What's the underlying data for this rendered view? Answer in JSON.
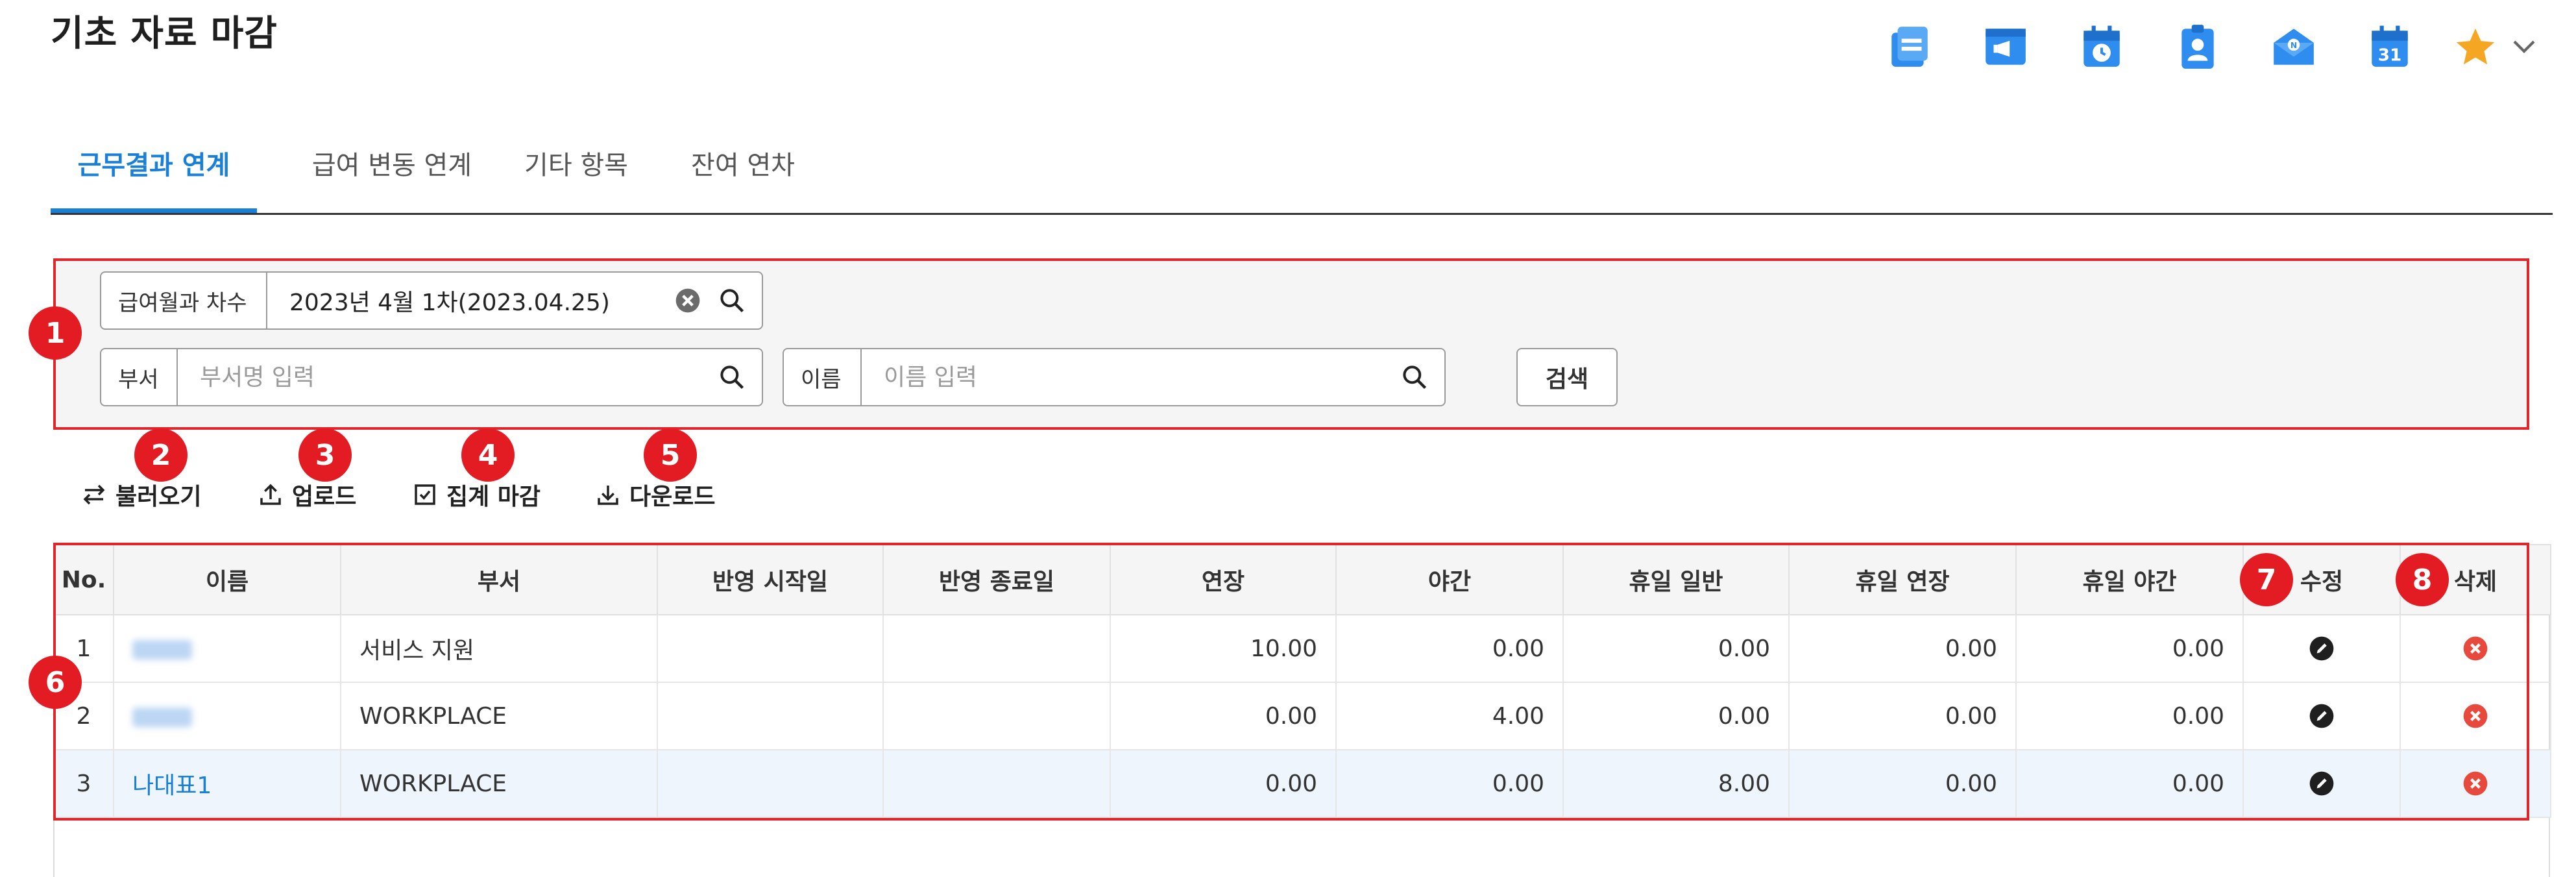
{
  "page": {
    "title": "기초 자료 마감"
  },
  "header": {
    "quick_icons": [
      {
        "icon": "board-icon",
        "color": "#2f8df0"
      },
      {
        "icon": "notice-icon",
        "color": "#2f8df0"
      },
      {
        "icon": "schedule-icon",
        "color": "#2f8df0"
      },
      {
        "icon": "id-card-icon",
        "color": "#2f8df0"
      },
      {
        "icon": "mail-icon",
        "color": "#2f8df0"
      },
      {
        "icon": "calendar-icon",
        "color": "#2f8df0",
        "text": "31"
      }
    ],
    "favorite": {
      "icon": "star-icon",
      "color": "#f5a623"
    }
  },
  "tabs": [
    {
      "label": "근무결과 연계",
      "active": true
    },
    {
      "label": "급여 변동 연계",
      "active": false
    },
    {
      "label": "기타 항목",
      "active": false
    },
    {
      "label": "잔여 연차",
      "active": false
    }
  ],
  "filters": {
    "period": {
      "label": "급여월과 차수",
      "value": "2023년 4월 1차(2023.04.25)"
    },
    "department": {
      "label": "부서",
      "placeholder": "부서명 입력"
    },
    "name": {
      "label": "이름",
      "placeholder": "이름 입력"
    },
    "search_label": "검색"
  },
  "toolbar": {
    "load": "불러오기",
    "upload": "업로드",
    "close_summary": "집계 마감",
    "download": "다운로드"
  },
  "badges": [
    "1",
    "2",
    "3",
    "4",
    "5",
    "6",
    "7",
    "8"
  ],
  "table": {
    "columns": [
      "No.",
      "이름",
      "부서",
      "반영 시작일",
      "반영 종료일",
      "연장",
      "야간",
      "휴일 일반",
      "휴일 연장",
      "휴일 야간",
      "수정",
      "삭제"
    ],
    "rows": [
      {
        "no": "1",
        "name": "",
        "dept": "서비스 지원",
        "start": "",
        "end": "",
        "overtime": "10.00",
        "night": "0.00",
        "holiday": "0.00",
        "holiday_overtime": "0.00",
        "holiday_night": "0.00"
      },
      {
        "no": "2",
        "name": "",
        "dept": "WORKPLACE",
        "start": "",
        "end": "",
        "overtime": "0.00",
        "night": "4.00",
        "holiday": "0.00",
        "holiday_overtime": "0.00",
        "holiday_night": "0.00"
      },
      {
        "no": "3",
        "name": "나대표1",
        "dept": "WORKPLACE",
        "start": "",
        "end": "",
        "overtime": "0.00",
        "night": "0.00",
        "holiday": "8.00",
        "holiday_overtime": "0.00",
        "holiday_night": "0.00"
      }
    ]
  },
  "colors": {
    "accent": "#1a7fd6",
    "highlight": "#e31b23",
    "edit": "#1f1f1f",
    "delete": "#e8493d"
  }
}
